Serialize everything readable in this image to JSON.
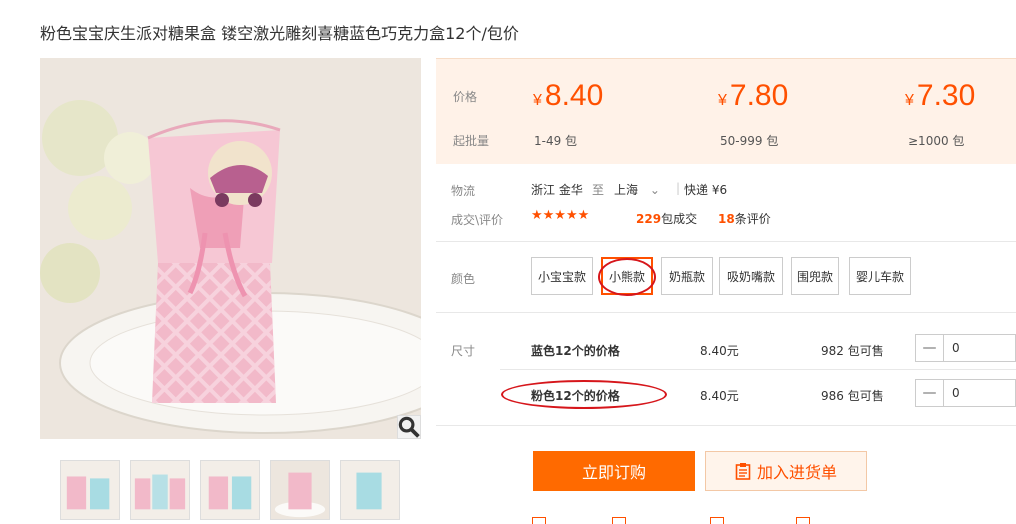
{
  "product": {
    "title": "粉色宝宝庆生派对糖果盒 镂空激光雕刻喜糖蓝色巧克力盒12个/包价",
    "thumbnail_count": 5
  },
  "pricing": {
    "price_label": "价格",
    "min_label": "起批量",
    "currency": "¥",
    "tiers": [
      {
        "price": "8.40",
        "range": "1-49 包"
      },
      {
        "price": "7.80",
        "range": "50-999 包"
      },
      {
        "price": "7.30",
        "range": "≥1000 包"
      }
    ]
  },
  "logistics": {
    "label": "物流",
    "from": "浙江 金华",
    "to_word": "至",
    "dest": "上海",
    "express": "快递 ¥6"
  },
  "reviews": {
    "label": "成交\\评价",
    "stars": "★★★★★",
    "sold_count": "229",
    "sold_text": "包成交",
    "review_count": "18",
    "review_text": "条评价"
  },
  "colors": {
    "label": "颜色",
    "options": [
      "小宝宝款",
      "小熊款",
      "奶瓶款",
      "吸奶嘴款",
      "围兜款",
      "婴儿车款"
    ],
    "selected": "小熊款"
  },
  "sizes": {
    "label": "尺寸",
    "rows": [
      {
        "name": "蓝色12个的价格",
        "price": "8.40元",
        "stock": "982 包可售",
        "qty": "0"
      },
      {
        "name": "粉色12个的价格",
        "price": "8.40元",
        "stock": "986 包可售",
        "qty": "0"
      }
    ]
  },
  "actions": {
    "buy_label": "立即订购",
    "cart_label": "加入进货单"
  },
  "theme": {
    "accent": "#ff5000",
    "annotation": "#d6161b"
  }
}
